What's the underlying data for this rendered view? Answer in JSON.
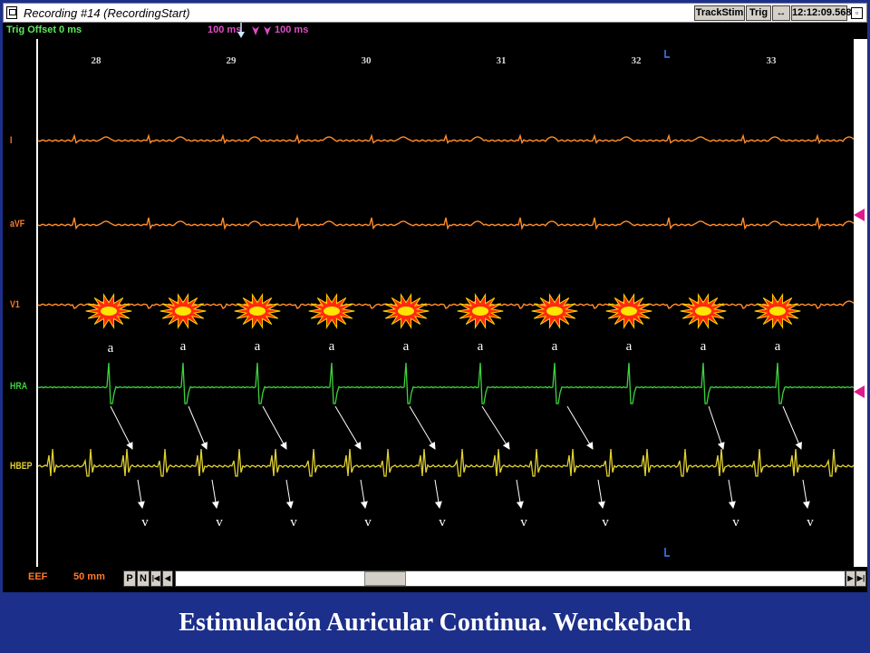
{
  "window": {
    "title": "Recording #14 (RecordingStart)",
    "buttons": [
      "TrackStim",
      "Trig",
      "↔"
    ],
    "time": "12:12:09.568",
    "min_icon": "minimize-icon"
  },
  "infobar": {
    "trig_offset": "Trig Offset 0 ms",
    "left_ms": "100 ms",
    "right_ms": "100 ms"
  },
  "time_axis": {
    "ticks": [
      "28",
      "29",
      "30",
      "31",
      "32",
      "33"
    ]
  },
  "channels": [
    {
      "label": "I",
      "color": "#ff8c2a"
    },
    {
      "label": "aVF",
      "color": "#ff8c2a"
    },
    {
      "label": "V1",
      "color": "#ff8c2a"
    },
    {
      "label": "HRA",
      "color": "#3cd43c"
    },
    {
      "label": "HBEP",
      "color": "#e0d030"
    }
  ],
  "annotations": {
    "a_label": "a",
    "v_label": "v",
    "a_count": 10,
    "v_count": 9
  },
  "bottombar": {
    "channel": "EEF",
    "speed": "50 mm",
    "buttons": [
      "P",
      "N",
      "|◀",
      "◀",
      "▶",
      "▶|"
    ]
  },
  "caption": "Estimulación Auricular Continua. Wenckebach"
}
